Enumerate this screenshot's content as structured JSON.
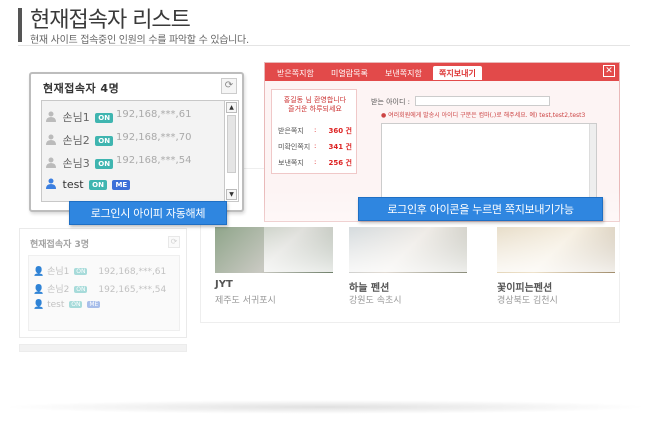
{
  "header": {
    "title": "현재접속자 리스트",
    "subtitle": "현재 사이트 접속중인 인원의 수를 파악할 수 있습니다."
  },
  "main_panel": {
    "title": "현재접속자 4명",
    "users": [
      {
        "name": "손님1",
        "badges": [
          "ON"
        ],
        "ip": "192,168,***,61"
      },
      {
        "name": "손님2",
        "badges": [
          "ON"
        ],
        "ip": "192,168,***,70"
      },
      {
        "name": "손님3",
        "badges": [
          "ON"
        ],
        "ip": "192,168,***,54"
      },
      {
        "name": "test",
        "badges": [
          "ON",
          "ME"
        ],
        "ip": ""
      }
    ]
  },
  "callouts": {
    "login_ip_hidden": "로그인시 아이피 자동해체",
    "message_hint": "로그인후 아이콘을 누르면 쪽지보내기가능"
  },
  "faded_panel": {
    "title": "현재접속자 3명",
    "users": [
      {
        "name": "손님1",
        "badges": [
          "ON"
        ],
        "ip": "192,168,***,61"
      },
      {
        "name": "손님2",
        "badges": [
          "ON"
        ],
        "ip": "192,165,***,54"
      },
      {
        "name": "test",
        "badges": [
          "ON",
          "ME"
        ],
        "ip": ""
      }
    ]
  },
  "message_window": {
    "tabs": [
      "받은쪽지함",
      "미열람목록",
      "보낸쪽지함",
      "쪽지보내기"
    ],
    "active_tab": "쪽지보내기",
    "close": "✕",
    "welcome_line1": "홍길동 님 환영합니다",
    "welcome_line2": "즐거운 하루되세요",
    "stats": [
      {
        "label": "받은쪽지",
        "value": "360 건"
      },
      {
        "label": "미확인쪽지",
        "value": "341 건"
      },
      {
        "label": "보낸쪽지",
        "value": "256 건"
      }
    ],
    "receiver_label": "받는 아이디 :",
    "receiver_note": "● 여러회원에게 발송시 아이디 구분은 컴마(,)로 해주세요. 예) test,test2,test3"
  },
  "picks": [
    {
      "name": "JYT",
      "location": "제주도 서귀포시"
    },
    {
      "name": "하늘 펜션",
      "location": "강원도 속초시"
    },
    {
      "name": "꽃이피는펜션",
      "location": "경상북도 김천시"
    }
  ],
  "colors": {
    "accent_blue": "#2f86e0",
    "badge_on": "#3fb5b0",
    "badge_me": "#3c6fd8",
    "message_red": "#e24a4a"
  },
  "icons": {
    "user": "user-icon",
    "refresh": "refresh-icon",
    "close": "close-icon"
  }
}
